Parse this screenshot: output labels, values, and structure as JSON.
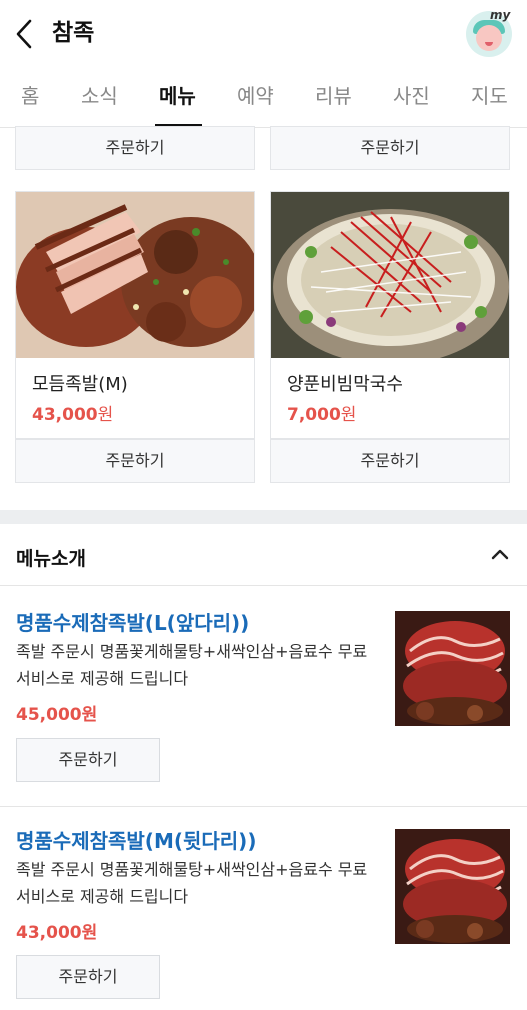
{
  "header": {
    "title": "참족",
    "my_label": "my"
  },
  "tabs": [
    {
      "label": "홈"
    },
    {
      "label": "소식"
    },
    {
      "label": "메뉴"
    },
    {
      "label": "예약"
    },
    {
      "label": "리뷰"
    },
    {
      "label": "사진"
    },
    {
      "label": "지도"
    }
  ],
  "active_tab": "메뉴",
  "grid_top_buttons": [
    "주문하기",
    "주문하기"
  ],
  "grid_items": [
    {
      "name": "모듬족발(M)",
      "price": "43,000",
      "unit": "원",
      "order_label": "주문하기"
    },
    {
      "name": "양푼비빔막국수",
      "price": "7,000",
      "unit": "원",
      "order_label": "주문하기"
    }
  ],
  "menu_intro": {
    "title": "메뉴소개",
    "items": [
      {
        "name": "명품수제참족발(L(앞다리))",
        "desc": "족발 주문시 명품꽃게해물탕+새싹인삼+음료수 무료서비스로 제공해 드립니다",
        "price": "45,000원",
        "order_label": "주문하기"
      },
      {
        "name": "명품수제참족발(M(뒷다리))",
        "desc": "족발 주문시 명품꽃게해물탕+새싹인삼+음료수 무료서비스로 제공해 드립니다",
        "price": "43,000원",
        "order_label": "주문하기"
      }
    ]
  },
  "colors": {
    "price": "#e5534b",
    "item_name": "#1a6bb8",
    "section_gap": "#eceef0"
  },
  "icons": [
    "back-arrow-icon",
    "my-avatar-icon",
    "chevron-up-icon"
  ]
}
